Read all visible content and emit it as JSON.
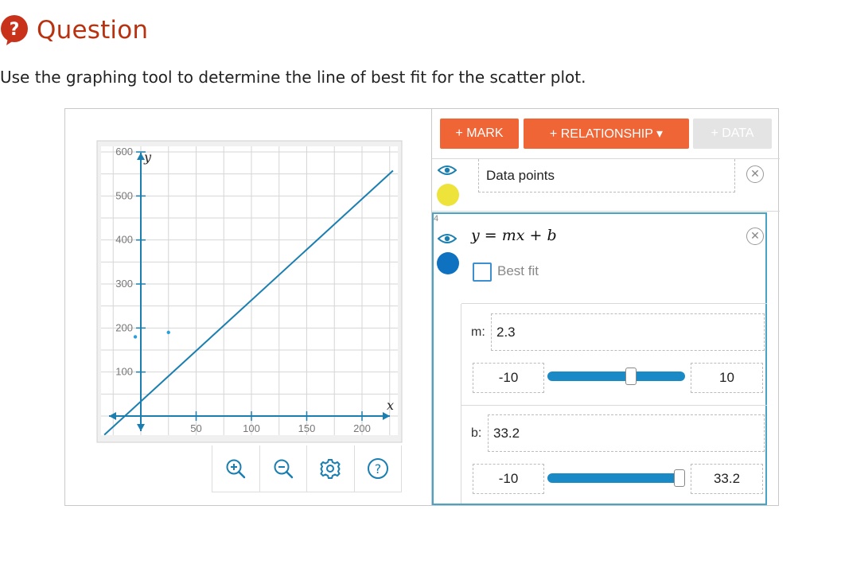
{
  "question": {
    "icon": "question-bubble-icon",
    "title": "Question",
    "text": "Use the graphing tool to determine the line of best fit for the scatter plot."
  },
  "graph": {
    "axis_x_label": "x",
    "axis_y_label": "y",
    "x_ticks": [
      "50",
      "100",
      "150",
      "200"
    ],
    "y_ticks": [
      "600",
      "500",
      "400",
      "300",
      "200",
      "100"
    ],
    "points": [
      [
        -5,
        180
      ],
      [
        25,
        190
      ]
    ],
    "line": {
      "m": 2.3,
      "b": 33.2
    },
    "line_color": "#1a7fb0",
    "tools": [
      "zoom-in-icon",
      "zoom-out-icon",
      "settings-gear-icon",
      "help-icon"
    ]
  },
  "panel": {
    "buttons": {
      "mark": "+ MARK",
      "relationship": "+ RELATIONSHIP ▾",
      "data": "+ DATA"
    },
    "data_row": {
      "label": "Data points",
      "color": "#ede33a"
    },
    "relation_row": {
      "index": "4",
      "equation": "y = mx + b",
      "color": "#0f72c1",
      "best_fit_label": "Best fit",
      "m": {
        "label": "m:",
        "value": "2.3",
        "min": "-10",
        "max": "10",
        "fraction": 0.615
      },
      "b": {
        "label": "b:",
        "value": "33.2",
        "min": "-10",
        "max": "33.2",
        "fraction": 1.0
      }
    },
    "accent_color": "#f06536",
    "selection_color": "#48a3c6"
  }
}
